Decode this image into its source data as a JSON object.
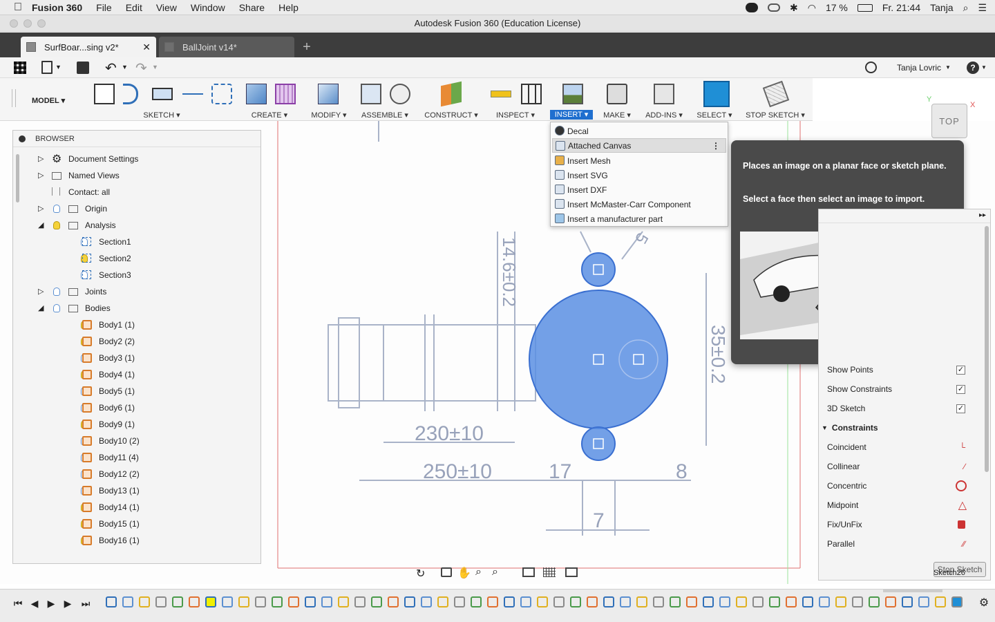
{
  "menubar": {
    "app": "Fusion 360",
    "items": [
      "File",
      "Edit",
      "View",
      "Window",
      "Share",
      "Help"
    ],
    "battery": "17 %",
    "clock": "Fr. 21:44",
    "user": "Tanja"
  },
  "window": {
    "title": "Autodesk Fusion 360 (Education License)"
  },
  "tabs": [
    {
      "label": "SurfBoar...sing v2*"
    },
    {
      "label": "BallJoint v14*"
    }
  ],
  "quickbar": {
    "user": "Tanja Lovric"
  },
  "toolbar": {
    "workspace": "MODEL",
    "groups": [
      "SKETCH",
      "CREATE",
      "MODIFY",
      "ASSEMBLE",
      "CONSTRUCT",
      "INSPECT",
      "INSERT",
      "MAKE",
      "ADD-INS",
      "SELECT",
      "STOP SKETCH"
    ]
  },
  "viewcube": {
    "face": "TOP",
    "x": "X",
    "y": "Y"
  },
  "browser": {
    "title": "BROWSER",
    "items": [
      {
        "label": "Document Settings"
      },
      {
        "label": "Named Views"
      },
      {
        "label": "Contact: all"
      },
      {
        "label": "Origin"
      },
      {
        "label": "Analysis"
      },
      {
        "label": "Section1"
      },
      {
        "label": "Section2"
      },
      {
        "label": "Section3"
      },
      {
        "label": "Joints"
      },
      {
        "label": "Bodies"
      },
      {
        "label": "Body1 (1)"
      },
      {
        "label": "Body2 (2)"
      },
      {
        "label": "Body3 (1)"
      },
      {
        "label": "Body4 (1)"
      },
      {
        "label": "Body5 (1)"
      },
      {
        "label": "Body6 (1)"
      },
      {
        "label": "Body9 (1)"
      },
      {
        "label": "Body10 (2)"
      },
      {
        "label": "Body11 (4)"
      },
      {
        "label": "Body12 (2)"
      },
      {
        "label": "Body13 (1)"
      },
      {
        "label": "Body14 (1)"
      },
      {
        "label": "Body15 (1)"
      },
      {
        "label": "Body16 (1)"
      }
    ]
  },
  "insert_menu": {
    "items": [
      "Decal",
      "Attached Canvas",
      "Insert Mesh",
      "Insert SVG",
      "Insert DXF",
      "Insert McMaster-Carr Component",
      "Insert a manufacturer part"
    ]
  },
  "tooltip": {
    "line1": "Places an image on a planar face or sketch plane.",
    "line2": "Select a face then select an image to import."
  },
  "drawing": {
    "dims": [
      "14.6±0.2",
      "35±0.2",
      "230±10",
      "250±10",
      "17",
      "8",
      "7",
      "5"
    ]
  },
  "sketch_palette": {
    "options": [
      {
        "label": "Show Points",
        "checked": "✓"
      },
      {
        "label": "Show Constraints",
        "checked": "✓"
      },
      {
        "label": "3D Sketch",
        "checked": "✓"
      }
    ],
    "section": "Constraints",
    "constraints": [
      {
        "label": "Coincident"
      },
      {
        "label": "Collinear"
      },
      {
        "label": "Concentric"
      },
      {
        "label": "Midpoint"
      },
      {
        "label": "Fix/UnFix"
      },
      {
        "label": "Parallel"
      }
    ],
    "stop_button": "Stop Sketch",
    "sketch_name": "Sketch26"
  }
}
